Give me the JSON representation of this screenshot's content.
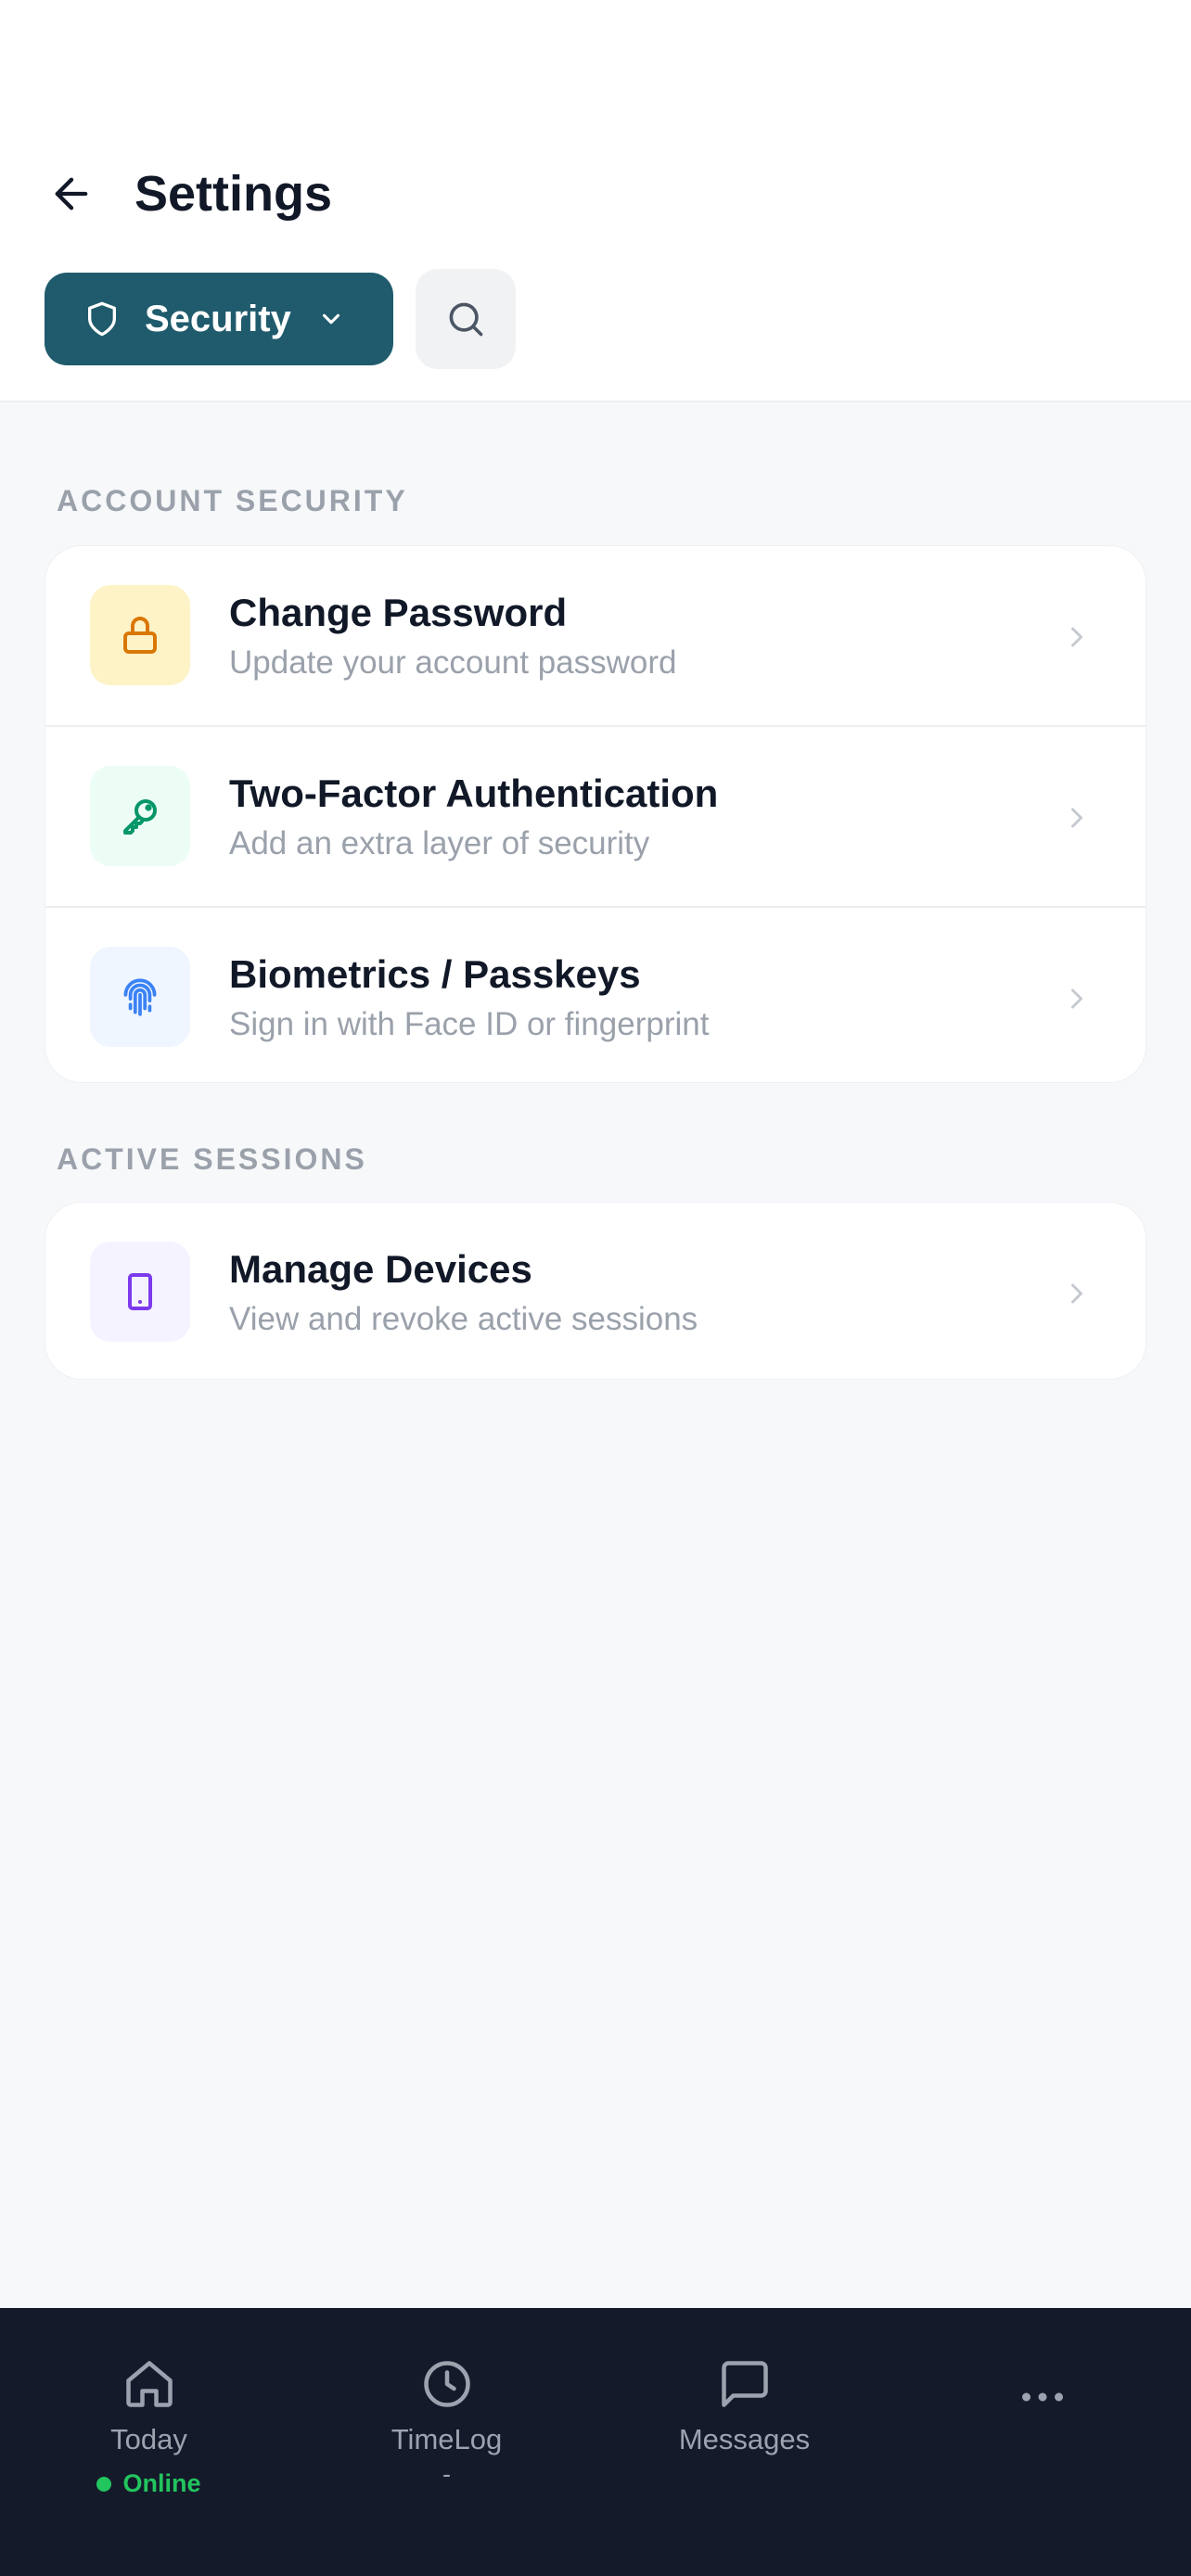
{
  "header": {
    "title": "Settings",
    "section_selector": {
      "label": "Security",
      "icon": "shield-icon"
    },
    "search_icon": "search-icon",
    "back_icon": "arrow-left-icon"
  },
  "sections": [
    {
      "label": "ACCOUNT SECURITY",
      "items": [
        {
          "title": "Change Password",
          "subtitle": "Update your account password",
          "icon": "lock-icon",
          "icon_bg": "#fef3c7",
          "icon_color": "#d97706"
        },
        {
          "title": "Two-Factor Authentication",
          "subtitle": "Add an extra layer of security",
          "icon": "key-icon",
          "icon_bg": "#ecfdf5",
          "icon_color": "#059669"
        },
        {
          "title": "Biometrics / Passkeys",
          "subtitle": "Sign in with Face ID or fingerprint",
          "icon": "fingerprint-icon",
          "icon_bg": "#eff6ff",
          "icon_color": "#3b82f6"
        }
      ]
    },
    {
      "label": "ACTIVE SESSIONS",
      "items": [
        {
          "title": "Manage Devices",
          "subtitle": "View and revoke active sessions",
          "icon": "smartphone-icon",
          "icon_bg": "#f5f3ff",
          "icon_color": "#7c3aed"
        }
      ]
    }
  ],
  "bottom_nav": {
    "items": [
      {
        "label": "Today",
        "icon": "home-icon",
        "status": "Online"
      },
      {
        "label": "TimeLog",
        "icon": "clock-icon",
        "sublabel": "-"
      },
      {
        "label": "Messages",
        "icon": "message-square-icon"
      },
      {
        "label": "",
        "icon": "more-horizontal-icon"
      }
    ]
  },
  "colors": {
    "accent": "#1f5b6c",
    "nav_bg": "#141a2a",
    "online": "#22c55e"
  }
}
